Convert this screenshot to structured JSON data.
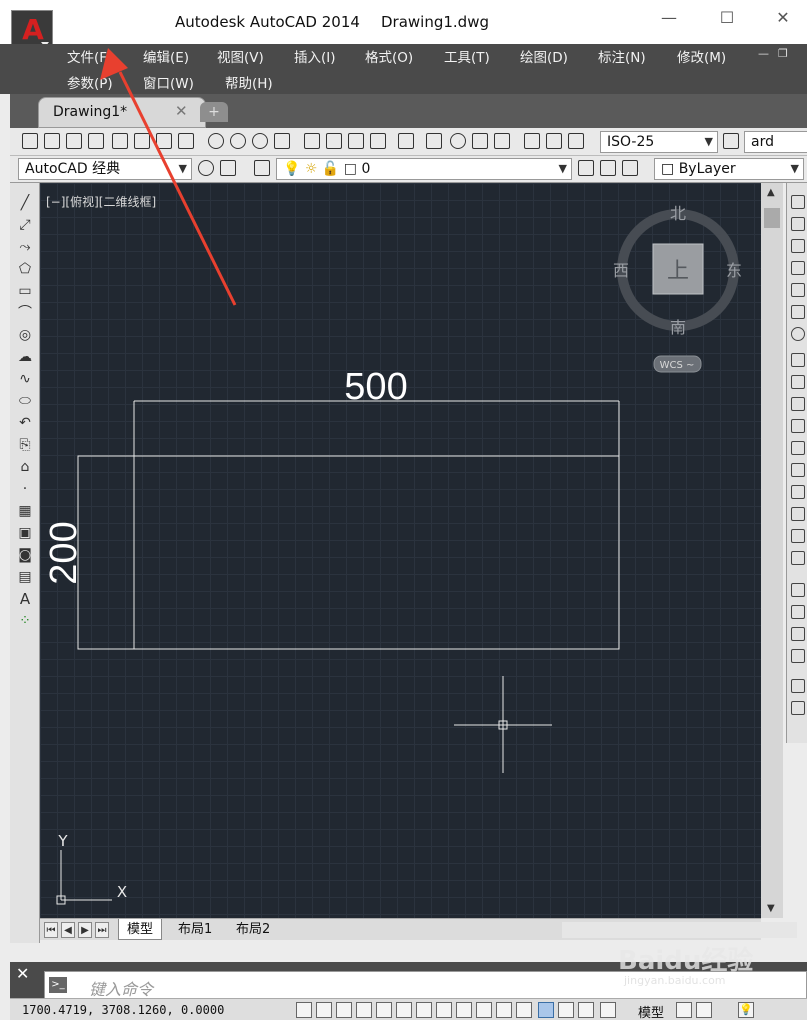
{
  "window": {
    "app_title": "Autodesk AutoCAD 2014",
    "doc_title": "Drawing1.dwg",
    "minimize": "—",
    "maximize": "☐",
    "close": "✕"
  },
  "menu": {
    "items": [
      "文件(F)",
      "编辑(E)",
      "视图(V)",
      "插入(I)",
      "格式(O)",
      "工具(T)",
      "绘图(D)",
      "标注(N)",
      "修改(M)",
      "参数(P)",
      "窗口(W)",
      "帮助(H)"
    ]
  },
  "tabs": {
    "active_label": "Drawing1*",
    "close": "✕",
    "new_tab": "+"
  },
  "toolbar1": {
    "dimstyle": "ISO-25",
    "textstyle": "ard"
  },
  "toolbar2": {
    "workspace": "AutoCAD 经典",
    "layer": "0",
    "color": "ByLayer"
  },
  "viewport": {
    "label": "[−][俯视][二维线框]",
    "dimension_horizontal": "500",
    "dimension_vertical": "200",
    "viewcube": {
      "north": "北",
      "south": "南",
      "east": "东",
      "west": "西",
      "face": "上",
      "wcs": "WCS ~"
    },
    "ucs": {
      "x": "X",
      "y": "Y"
    }
  },
  "layout_tabs": [
    "模型",
    "布局1",
    "布局2"
  ],
  "command": {
    "placeholder": "键入命令",
    "close": "✕"
  },
  "status": {
    "coordinates": "1700.4719, 3708.1260, 0.0000",
    "space": "模型"
  },
  "watermark": {
    "brand": "Baidu经验",
    "url": "jingyan.baidu.com"
  },
  "colors": {
    "canvas": "#212831",
    "menubar": "#4a4a4a",
    "annotation_arrow": "#e8402f",
    "app_logo": "#d42020"
  }
}
